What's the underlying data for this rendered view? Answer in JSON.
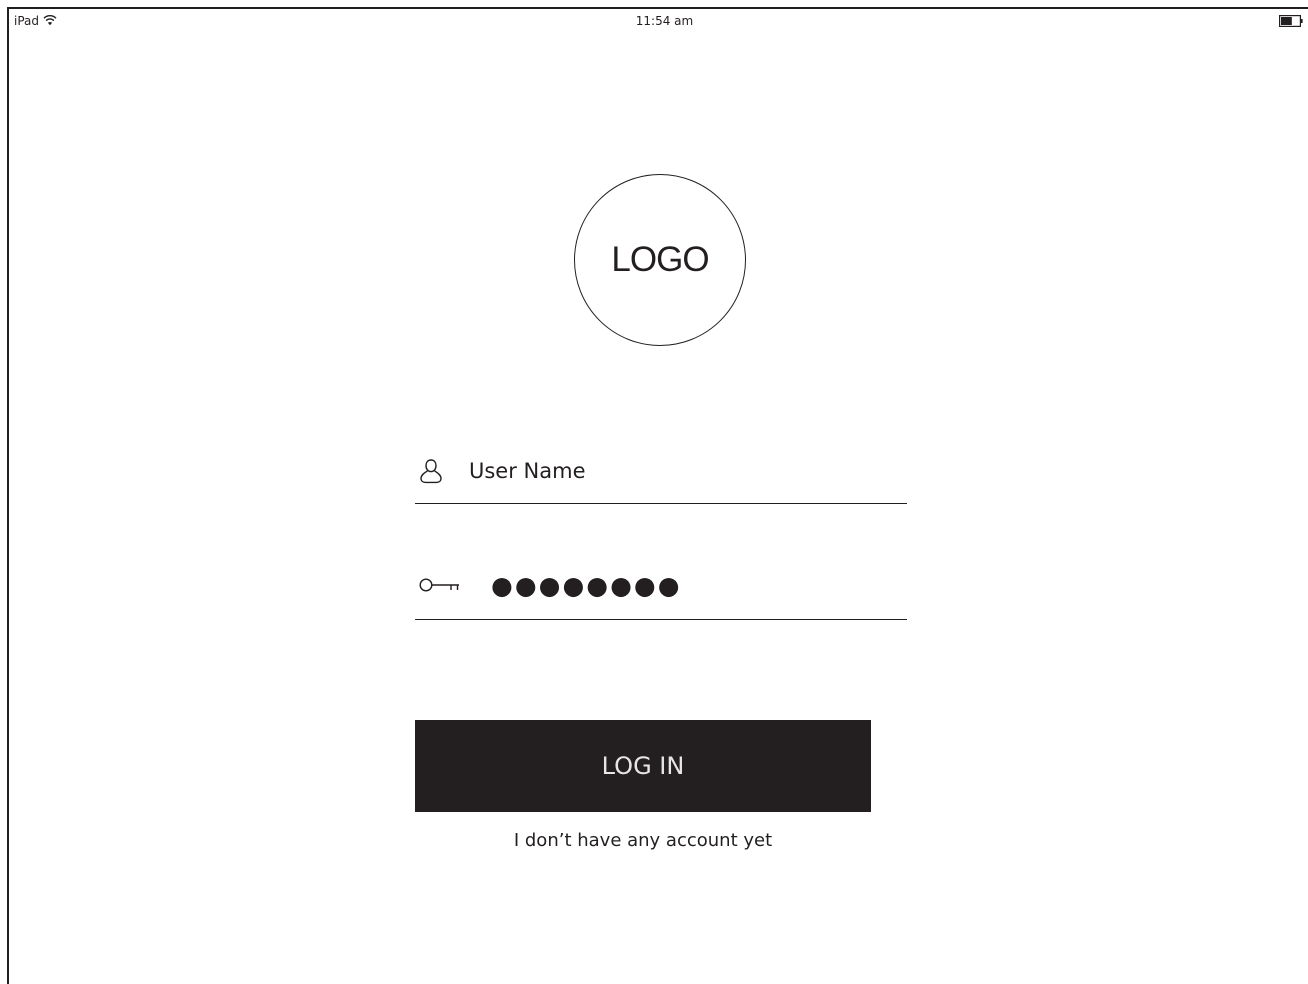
{
  "status_bar": {
    "device": "iPad",
    "wifi_icon": "wifi-icon",
    "time": "11:54 am",
    "battery_icon": "battery-icon",
    "battery_level": 0.6
  },
  "logo": {
    "text": "LOGO"
  },
  "form": {
    "username": {
      "icon": "user-icon",
      "placeholder": "User Name"
    },
    "password": {
      "icon": "key-icon",
      "value": "●●●●●●●●"
    },
    "login_label": "LOG IN",
    "signup_link": "I don’t have any account yet"
  },
  "colors": {
    "primary": "#231f20",
    "button_text": "#e6e6e6",
    "background": "#ffffff"
  }
}
